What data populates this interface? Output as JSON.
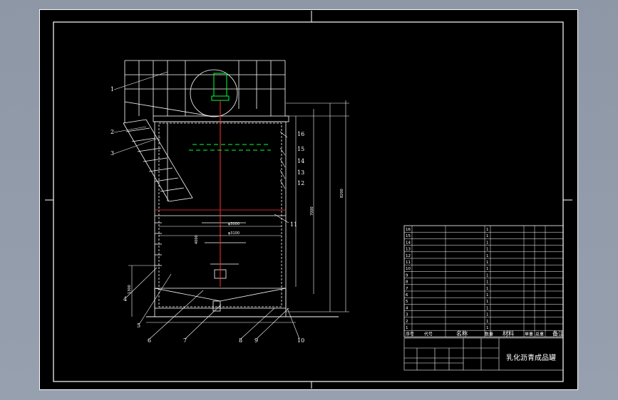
{
  "drawing": {
    "title": "乳化沥青成品罐",
    "balloons": [
      "1",
      "2",
      "3",
      "4",
      "5",
      "6",
      "7",
      "8",
      "9",
      "10",
      "11",
      "12",
      "13",
      "14",
      "15",
      "16"
    ],
    "dims": {
      "d1": "φ3000",
      "d2": "φ3100",
      "d3": "4000",
      "d4": "7000",
      "d5": "8200",
      "d6": "1300"
    },
    "bom_header": [
      "序号",
      "代号",
      "名称",
      "数量",
      "材料",
      "单重",
      "总重",
      "备注"
    ],
    "bom_rows": [
      {
        "no": "16",
        "name": "",
        "qty": "1",
        "mat": "",
        "rem": ""
      },
      {
        "no": "15",
        "name": "",
        "qty": "1",
        "mat": "",
        "rem": ""
      },
      {
        "no": "14",
        "name": "",
        "qty": "1",
        "mat": "",
        "rem": ""
      },
      {
        "no": "13",
        "name": "",
        "qty": "1",
        "mat": "",
        "rem": ""
      },
      {
        "no": "12",
        "name": "",
        "qty": "1",
        "mat": "",
        "rem": ""
      },
      {
        "no": "11",
        "name": "",
        "qty": "1",
        "mat": "",
        "rem": ""
      },
      {
        "no": "10",
        "name": "",
        "qty": "1",
        "mat": "",
        "rem": ""
      },
      {
        "no": "9",
        "name": "",
        "qty": "1",
        "mat": "",
        "rem": ""
      },
      {
        "no": "8",
        "name": "",
        "qty": "1",
        "mat": "",
        "rem": ""
      },
      {
        "no": "7",
        "name": "",
        "qty": "1",
        "mat": "",
        "rem": ""
      },
      {
        "no": "6",
        "name": "",
        "qty": "1",
        "mat": "",
        "rem": ""
      },
      {
        "no": "5",
        "name": "",
        "qty": "1",
        "mat": "",
        "rem": ""
      },
      {
        "no": "4",
        "name": "",
        "qty": "1",
        "mat": "",
        "rem": ""
      },
      {
        "no": "3",
        "name": "",
        "qty": "1",
        "mat": "",
        "rem": ""
      },
      {
        "no": "2",
        "name": "",
        "qty": "1",
        "mat": "",
        "rem": ""
      },
      {
        "no": "1",
        "name": "",
        "qty": "1",
        "mat": "",
        "rem": ""
      }
    ],
    "colors": {
      "line": "#ffffff",
      "accent_green": "#00ff3c",
      "accent_red": "#ff3030",
      "background": "#000000"
    }
  }
}
